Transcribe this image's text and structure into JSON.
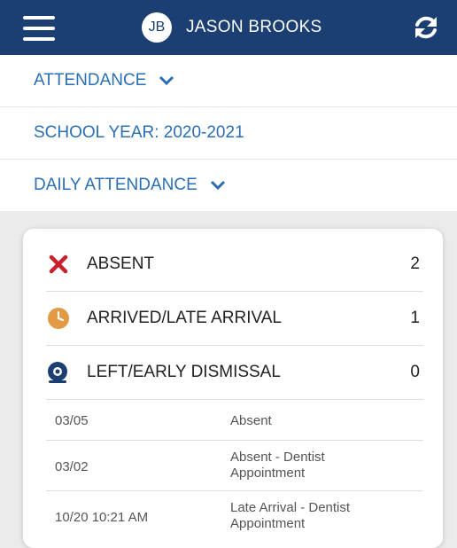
{
  "header": {
    "avatar_initials": "JB",
    "user_name": "JASON BROOKS",
    "menu_icon": "hamburger-menu-icon",
    "refresh_icon": "refresh-icon",
    "background_color": "#1b3f73"
  },
  "nav": {
    "attendance_label": "ATTENDANCE",
    "school_year_label": "SCHOOL YEAR: 2020-2021",
    "daily_attendance_label": "DAILY ATTENDANCE",
    "link_color": "#2a6fb5"
  },
  "summary": [
    {
      "label": "ABSENT",
      "count": "2",
      "icon": "x-mark-icon",
      "color": "#c8202d"
    },
    {
      "label": "ARRIVED/LATE ARRIVAL",
      "count": "1",
      "icon": "clock-icon",
      "color": "#e39a44"
    },
    {
      "label": "LEFT/EARLY DISMISSAL",
      "count": "0",
      "icon": "departure-icon",
      "color": "#1b3f73"
    }
  ],
  "details": [
    {
      "date": "03/05",
      "description": "Absent"
    },
    {
      "date": "03/02",
      "description": "Absent - Dentist Appointment"
    },
    {
      "date": "10/20 10:21 AM",
      "description": "Late Arrival - Dentist Appointment"
    }
  ]
}
